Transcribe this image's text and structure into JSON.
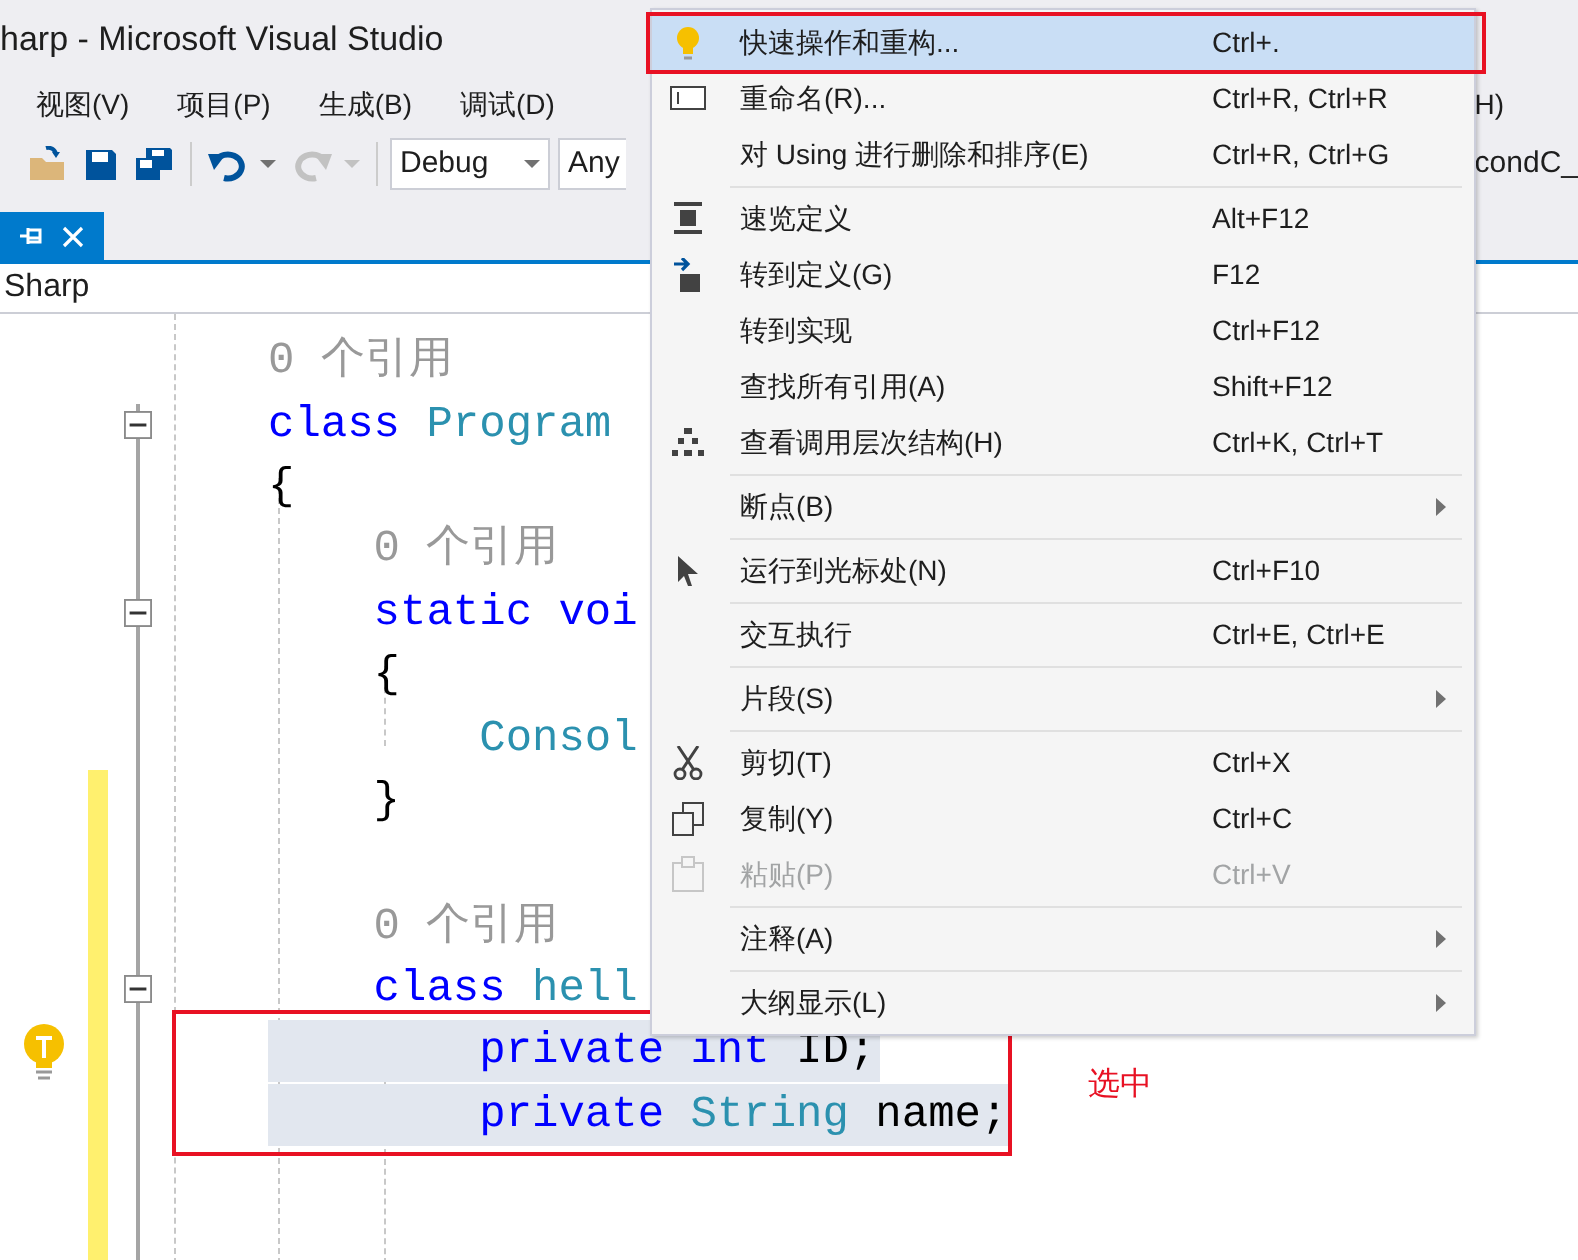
{
  "window": {
    "title": "harp - Microsoft Visual Studio"
  },
  "menu_bar": {
    "items": [
      "视图(V)",
      "项目(P)",
      "生成(B)",
      "调试(D)"
    ],
    "fragment": "H)"
  },
  "toolbar": {
    "buttons": [
      {
        "kind": "open",
        "disabled": false
      },
      {
        "kind": "save",
        "disabled": false
      },
      {
        "kind": "save_all",
        "disabled": false
      },
      {
        "kind": "undo",
        "disabled": false
      },
      {
        "kind": "redo",
        "disabled": true
      }
    ],
    "configuration": "Debug",
    "platform": "Any",
    "fragment": "condC_"
  },
  "navigation_bar": {
    "text": "Sharp"
  },
  "code_lines": [
    {
      "collapsible": false,
      "changed": false,
      "selected": false,
      "tokens": [
        {
          "kind": "lens",
          "text": "0 个引用"
        }
      ]
    },
    {
      "collapsible": true,
      "changed": false,
      "selected": false,
      "tokens": [
        {
          "kind": "keyword",
          "text": "class"
        },
        {
          "kind": "type",
          "text": " Program"
        }
      ]
    },
    {
      "collapsible": false,
      "changed": false,
      "selected": false,
      "tokens": [
        {
          "kind": "plain",
          "text": "{"
        }
      ]
    },
    {
      "collapsible": false,
      "changed": false,
      "selected": false,
      "tokens": [
        {
          "kind": "lens",
          "text": "    0 个引用"
        }
      ]
    },
    {
      "collapsible": true,
      "changed": false,
      "selected": false,
      "tokens": [
        {
          "kind": "keyword",
          "text": "    static voi"
        }
      ]
    },
    {
      "collapsible": false,
      "changed": false,
      "selected": false,
      "tokens": [
        {
          "kind": "plain",
          "text": "    {"
        }
      ]
    },
    {
      "collapsible": false,
      "changed": false,
      "selected": false,
      "tokens": [
        {
          "kind": "type",
          "text": "        Consol"
        }
      ]
    },
    {
      "collapsible": false,
      "changed": true,
      "selected": false,
      "tokens": [
        {
          "kind": "plain",
          "text": "    }"
        }
      ]
    },
    {
      "collapsible": false,
      "changed": true,
      "selected": false
    },
    {
      "collapsible": false,
      "changed": true,
      "selected": false,
      "tokens": [
        {
          "kind": "lens",
          "text": "    0 个引用"
        }
      ]
    },
    {
      "collapsible": true,
      "changed": true,
      "selected": false,
      "tokens": [
        {
          "kind": "keyword",
          "text": "    class"
        },
        {
          "kind": "type",
          "text": " hell"
        }
      ]
    },
    {
      "collapsible": false,
      "changed": true,
      "selected": true,
      "lightbulb": true,
      "tokens": [
        {
          "kind": "keyword",
          "text": "        private int"
        },
        {
          "kind": "plain",
          "text": " ID;"
        }
      ]
    },
    {
      "collapsible": false,
      "changed": true,
      "selected": true,
      "tokens": [
        {
          "kind": "keyword",
          "text": "        private"
        },
        {
          "kind": "type",
          "text": " String"
        },
        {
          "kind": "plain",
          "text": " name;"
        }
      ]
    },
    {
      "collapsible": false,
      "changed": true,
      "selected": false
    },
    {
      "collapsible": false,
      "changed": true,
      "selected": false
    }
  ],
  "context_menu": {
    "items": [
      {
        "kind": "item",
        "label": "快速操作和重构...",
        "shortcut": "Ctrl+.",
        "selected": true,
        "disabled": false,
        "submenu": false
      },
      {
        "kind": "item",
        "label": "重命名(R)...",
        "shortcut": "Ctrl+R, Ctrl+R",
        "selected": false,
        "disabled": false,
        "submenu": false
      },
      {
        "kind": "item",
        "label": "对 Using 进行删除和排序(E)",
        "shortcut": "Ctrl+R, Ctrl+G",
        "selected": false,
        "disabled": false,
        "submenu": false
      },
      {
        "kind": "separator"
      },
      {
        "kind": "item",
        "label": "速览定义",
        "shortcut": "Alt+F12",
        "selected": false,
        "disabled": false,
        "submenu": false
      },
      {
        "kind": "item",
        "label": "转到定义(G)",
        "shortcut": "F12",
        "selected": false,
        "disabled": false,
        "submenu": false
      },
      {
        "kind": "item",
        "label": "转到实现",
        "shortcut": "Ctrl+F12",
        "selected": false,
        "disabled": false,
        "submenu": false
      },
      {
        "kind": "item",
        "label": "查找所有引用(A)",
        "shortcut": "Shift+F12",
        "selected": false,
        "disabled": false,
        "submenu": false
      },
      {
        "kind": "item",
        "label": "查看调用层次结构(H)",
        "shortcut": "Ctrl+K, Ctrl+T",
        "selected": false,
        "disabled": false,
        "submenu": false
      },
      {
        "kind": "separator"
      },
      {
        "kind": "item",
        "label": "断点(B)",
        "selected": false,
        "disabled": false,
        "submenu": true
      },
      {
        "kind": "separator"
      },
      {
        "kind": "item",
        "label": "运行到光标处(N)",
        "shortcut": "Ctrl+F10",
        "selected": false,
        "disabled": false,
        "submenu": false
      },
      {
        "kind": "separator"
      },
      {
        "kind": "item",
        "label": "交互执行",
        "shortcut": "Ctrl+E, Ctrl+E",
        "selected": false,
        "disabled": false,
        "submenu": false
      },
      {
        "kind": "separator"
      },
      {
        "kind": "item",
        "label": "片段(S)",
        "selected": false,
        "disabled": false,
        "submenu": true
      },
      {
        "kind": "separator"
      },
      {
        "kind": "item",
        "label": "剪切(T)",
        "shortcut": "Ctrl+X",
        "selected": false,
        "disabled": false,
        "submenu": false
      },
      {
        "kind": "item",
        "label": "复制(Y)",
        "shortcut": "Ctrl+C",
        "selected": false,
        "disabled": false,
        "submenu": false
      },
      {
        "kind": "item",
        "label": "粘贴(P)",
        "shortcut": "Ctrl+V",
        "selected": false,
        "disabled": true,
        "submenu": false
      },
      {
        "kind": "separator"
      },
      {
        "kind": "item",
        "label": "注释(A)",
        "selected": false,
        "disabled": false,
        "submenu": true
      },
      {
        "kind": "separator"
      },
      {
        "kind": "item",
        "label": "大纲显示(L)",
        "selected": false,
        "disabled": false,
        "submenu": true
      }
    ]
  },
  "annotation": {
    "label": "选中"
  }
}
